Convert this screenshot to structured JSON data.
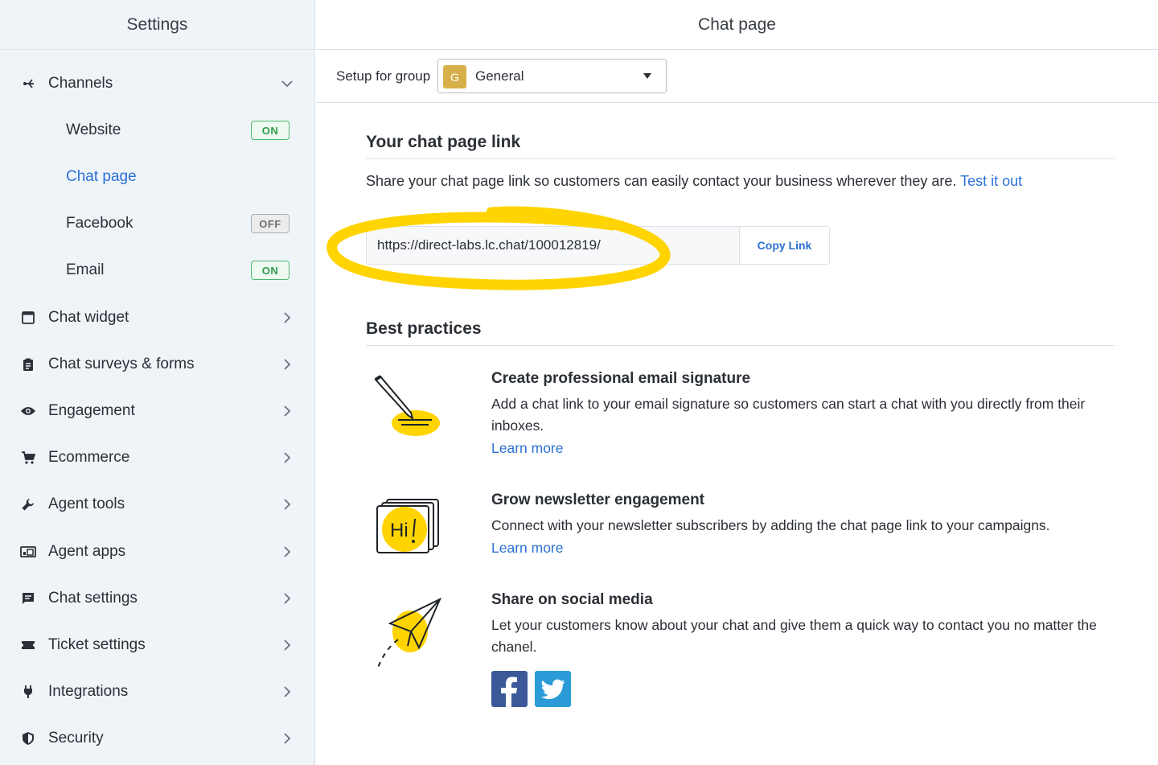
{
  "sidebar": {
    "title": "Settings",
    "channels": {
      "label": "Channels",
      "sub_items": [
        {
          "label": "Website",
          "toggle": "ON"
        },
        {
          "label": "Chat page",
          "toggle": ""
        },
        {
          "label": "Facebook",
          "toggle": "OFF"
        },
        {
          "label": "Email",
          "toggle": "ON"
        }
      ]
    },
    "items": [
      {
        "label": "Chat widget",
        "icon": "widget-icon"
      },
      {
        "label": "Chat surveys & forms",
        "icon": "clipboard-icon"
      },
      {
        "label": "Engagement",
        "icon": "eye-icon"
      },
      {
        "label": "Ecommerce",
        "icon": "cart-icon"
      },
      {
        "label": "Agent tools",
        "icon": "wrench-icon"
      },
      {
        "label": "Agent apps",
        "icon": "apps-icon"
      },
      {
        "label": "Chat settings",
        "icon": "chat-bubble-icon"
      },
      {
        "label": "Ticket settings",
        "icon": "ticket-icon"
      },
      {
        "label": "Integrations",
        "icon": "plug-icon"
      },
      {
        "label": "Security",
        "icon": "shield-icon"
      }
    ]
  },
  "main": {
    "title": "Chat page",
    "group": {
      "label": "Setup for group",
      "avatar": "G",
      "value": "General"
    },
    "link_section": {
      "title": "Your chat page link",
      "description": "Share your chat page link so customers can easily contact your business wherever they are.",
      "test_link": "Test it out",
      "url": "https://direct-labs.lc.chat/100012819/",
      "copy_label": "Copy Link"
    },
    "best_practices": {
      "title": "Best practices",
      "items": [
        {
          "title": "Create professional email signature",
          "text": "Add a chat link to your email signature so customers can start a chat with you directly from their inboxes.",
          "link": "Learn more"
        },
        {
          "title": "Grow newsletter engagement",
          "text": "Connect with your newsletter subscribers by adding the chat page link to your campaigns.",
          "link": "Learn more"
        },
        {
          "title": "Share on social media",
          "text": "Let your customers know about your chat and give them a quick way to contact you no matter the chanel.",
          "link": ""
        }
      ],
      "illustration_text": "Hi"
    }
  },
  "colors": {
    "accent": "#2a71d4",
    "highlight": "#ffd400",
    "sidebar_bg": "#eff4f9",
    "facebook": "#3b5998",
    "twitter": "#2a9bd6"
  }
}
